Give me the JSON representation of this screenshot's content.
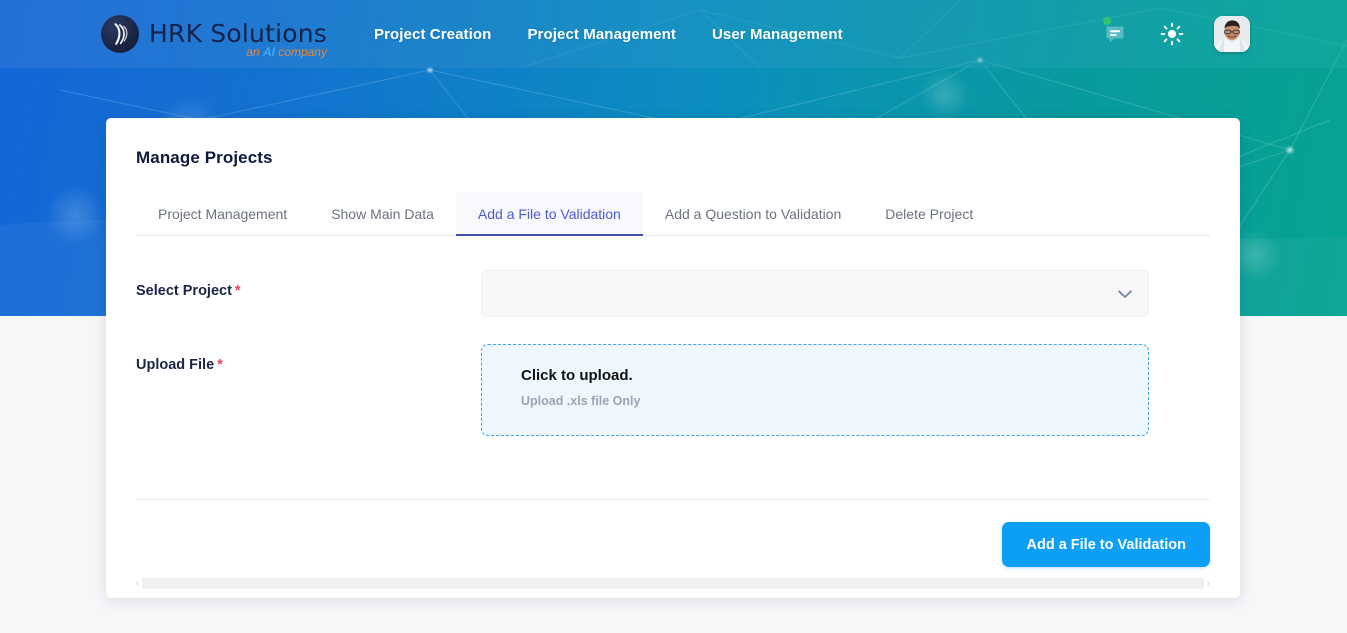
{
  "navbar": {
    "brand": {
      "title": "HRK Solutions",
      "tagline_pre": "an ",
      "tagline_ai": "AI",
      "tagline_post": " company"
    },
    "links": [
      {
        "label": "Project Creation"
      },
      {
        "label": "Project Management"
      },
      {
        "label": "User Management"
      }
    ],
    "icons": {
      "chat": "chat-icon",
      "theme": "sun-icon",
      "avatar": "user-avatar"
    }
  },
  "card": {
    "title": "Manage Projects",
    "tabs": [
      {
        "label": "Project Management",
        "active": false
      },
      {
        "label": "Show Main Data",
        "active": false
      },
      {
        "label": "Add a File to Validation",
        "active": true
      },
      {
        "label": "Add a Question to Validation",
        "active": false
      },
      {
        "label": "Delete Project",
        "active": false
      }
    ],
    "fields": {
      "select_project": {
        "label": "Select Project",
        "required": "*",
        "value": "",
        "placeholder": ""
      },
      "upload_file": {
        "label": "Upload File",
        "required": "*",
        "title": "Click to upload.",
        "subtitle": "Upload .xls file Only"
      }
    },
    "submit_label": "Add a File to Validation",
    "scroll": {
      "left_arrow": "‹",
      "right_arrow": "›"
    }
  },
  "colors": {
    "accent_blue": "#0d9ff5",
    "tab_active": "#3f51b5",
    "required_red": "#f43f5e",
    "dropzone_border": "#3ea2f0",
    "badge_green": "#38c172",
    "brand_orange": "#e8873a",
    "brand_ai_blue": "#3fa9f5"
  }
}
